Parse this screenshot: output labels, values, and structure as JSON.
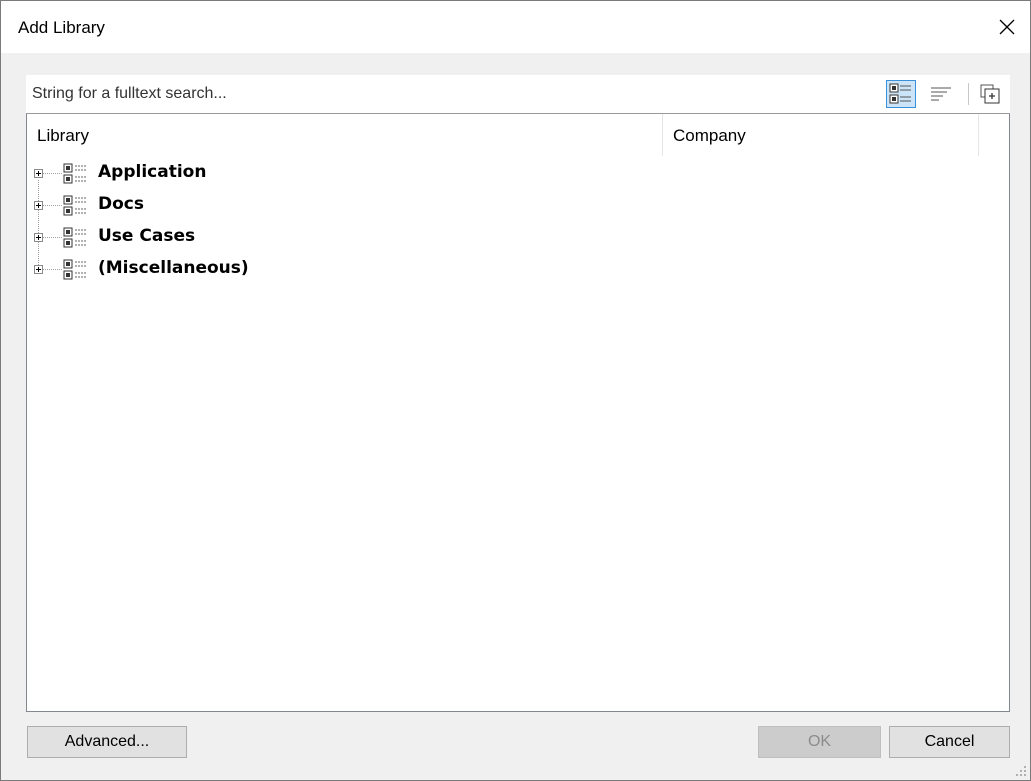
{
  "window": {
    "title": "Add Library",
    "close_icon": "close-icon"
  },
  "search": {
    "placeholder": "String for a fulltext search...",
    "value": "",
    "toolbar": [
      {
        "name": "tree-view-icon",
        "active": true
      },
      {
        "name": "list-view-icon",
        "active": false
      },
      {
        "name": "add-library-icon",
        "active": false
      }
    ]
  },
  "tree": {
    "columns": [
      "Library",
      "Company"
    ],
    "nodes": [
      {
        "label": "Application",
        "icon": "library-icon",
        "expander": "plus-icon"
      },
      {
        "label": "Docs",
        "icon": "library-icon",
        "expander": "plus-icon"
      },
      {
        "label": "Use Cases",
        "icon": "library-icon",
        "expander": "plus-icon"
      },
      {
        "label": "(Miscellaneous)",
        "icon": "library-icon",
        "expander": "plus-icon"
      }
    ]
  },
  "buttons": {
    "advanced": "Advanced...",
    "ok": "OK",
    "cancel": "Cancel"
  },
  "colors": {
    "accent": "#3c8fd9",
    "active_bg": "#cce4f7",
    "dialog_bg": "#f0f0f0"
  }
}
